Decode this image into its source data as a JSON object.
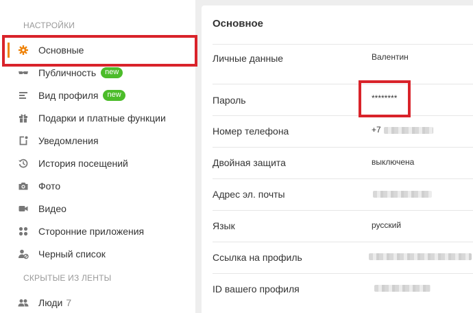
{
  "sidebar": {
    "section_settings": "НАСТРОЙКИ",
    "items": [
      {
        "label": "Основные",
        "icon": "gear-icon"
      },
      {
        "label": "Публичность",
        "badge": "new",
        "icon": "glasses-icon"
      },
      {
        "label": "Вид профиля",
        "badge": "new",
        "icon": "lines-icon"
      },
      {
        "label": "Подарки и платные функции",
        "icon": "gift-icon"
      },
      {
        "label": "Уведомления",
        "icon": "bell-square-icon"
      },
      {
        "label": "История посещений",
        "icon": "history-icon"
      },
      {
        "label": "Фото",
        "icon": "camera-icon"
      },
      {
        "label": "Видео",
        "icon": "video-icon"
      },
      {
        "label": "Сторонние приложения",
        "icon": "apps-icon"
      },
      {
        "label": "Черный список",
        "icon": "blocked-user-icon"
      }
    ],
    "section_hidden": "СКРЫТЫЕ ИЗ ЛЕНТЫ",
    "hidden_items": [
      {
        "label": "Люди",
        "count": "7",
        "icon": "people-icon"
      }
    ],
    "accent_color": "#ee8208"
  },
  "main": {
    "title": "Основное",
    "rows": [
      {
        "label": "Личные данные",
        "value": "Валентин"
      },
      {
        "label": "Пароль",
        "value": "********"
      },
      {
        "label": "Номер телефона",
        "value": "+7"
      },
      {
        "label": "Двойная защита",
        "value": "выключена"
      },
      {
        "label": "Адрес эл. почты",
        "value": ""
      },
      {
        "label": "Язык",
        "value": "русский"
      },
      {
        "label": "Ссылка на профиль",
        "value": ""
      },
      {
        "label": "ID вашего профиля",
        "value": ""
      }
    ]
  },
  "colors": {
    "badge": "#4cbc2a",
    "highlight": "#d9232a"
  }
}
